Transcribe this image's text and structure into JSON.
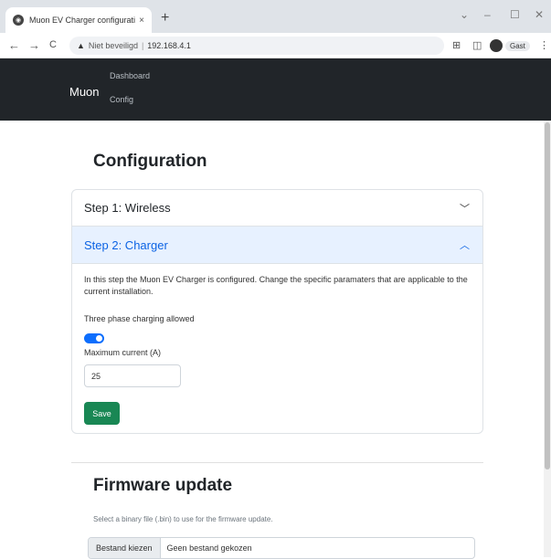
{
  "browser": {
    "tab_title": "Muon EV Charger configuration",
    "tab_close": "×",
    "new_tab": "+",
    "window_controls": {
      "minimize": "–",
      "restore": "☐",
      "close": "✕",
      "dropdown": "⌄"
    },
    "nav": {
      "back": "←",
      "forward": "→",
      "reload": "C"
    },
    "security_label": "Niet beveiligd",
    "url": "192.168.4.1",
    "profile_label": "Gast",
    "icons": [
      "translate-icon",
      "sidebar-icon",
      "profile-icon",
      "menu-icon"
    ]
  },
  "navbar": {
    "brand": "Muon",
    "links": [
      "Dashboard",
      "Config"
    ]
  },
  "configuration": {
    "title": "Configuration",
    "step1": {
      "label": "Step 1: Wireless",
      "expanded": false
    },
    "step2": {
      "label": "Step 2: Charger",
      "expanded": true,
      "description": "In this step the Muon EV Charger is configured. Change the specific paramaters that are applicable to the current installation.",
      "three_phase_label": "Three phase charging allowed",
      "three_phase_enabled": true,
      "max_current_label": "Maximum current (A)",
      "max_current_value": "25",
      "save_label": "Save"
    }
  },
  "firmware": {
    "title": "Firmware update",
    "help": "Select a binary file (.bin) to use for the firmware update.",
    "file_button": "Bestand kiezen",
    "file_status": "Geen bestand gekozen"
  },
  "colors": {
    "navbar_bg": "#212529",
    "accordion_active_bg": "#e7f1ff",
    "accordion_active_text": "#0c63e4",
    "toggle_on": "#0d6efd",
    "save_button": "#198754"
  }
}
